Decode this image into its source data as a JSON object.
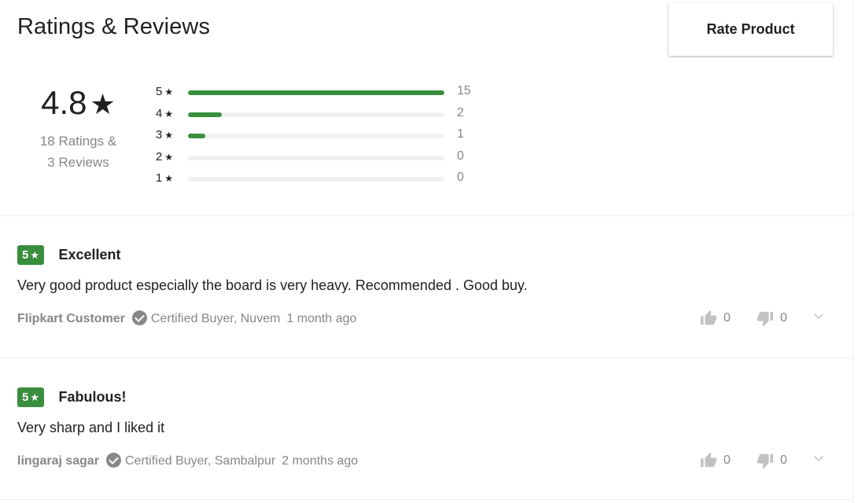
{
  "header": {
    "title": "Ratings & Reviews",
    "rate_button": "Rate Product"
  },
  "summary": {
    "average": "4.8",
    "star": "★",
    "ratings_line": "18 Ratings &",
    "reviews_line": "3 Reviews"
  },
  "distribution": [
    {
      "label": "5",
      "star": "★",
      "count": "15",
      "fraction": 1.0
    },
    {
      "label": "4",
      "star": "★",
      "count": "2",
      "fraction": 0.1333
    },
    {
      "label": "3",
      "star": "★",
      "count": "1",
      "fraction": 0.0667
    },
    {
      "label": "2",
      "star": "★",
      "count": "0",
      "fraction": 0
    },
    {
      "label": "1",
      "star": "★",
      "count": "0",
      "fraction": 0
    }
  ],
  "reviews": [
    {
      "rating": "5",
      "star": "★",
      "title": "Excellent",
      "text": "Very good product especially the board is very heavy. Recommended . Good buy.",
      "author": "Flipkart Customer",
      "certified": "Certified Buyer, Nuvem",
      "time": "1 month ago",
      "likes": "0",
      "dislikes": "0"
    },
    {
      "rating": "5",
      "star": "★",
      "title": "Fabulous!",
      "text": "Very sharp and I liked it",
      "author": "lingaraj sagar",
      "certified": "Certified Buyer, Sambalpur",
      "time": "2 months ago",
      "likes": "0",
      "dislikes": "0"
    }
  ],
  "icons": [
    "thumbs-up-icon",
    "thumbs-down-icon",
    "chevron-down-icon",
    "certified-check-icon"
  ],
  "colors": {
    "accent": "#388e3c",
    "muted": "#878787",
    "track": "#f0f0f0"
  }
}
